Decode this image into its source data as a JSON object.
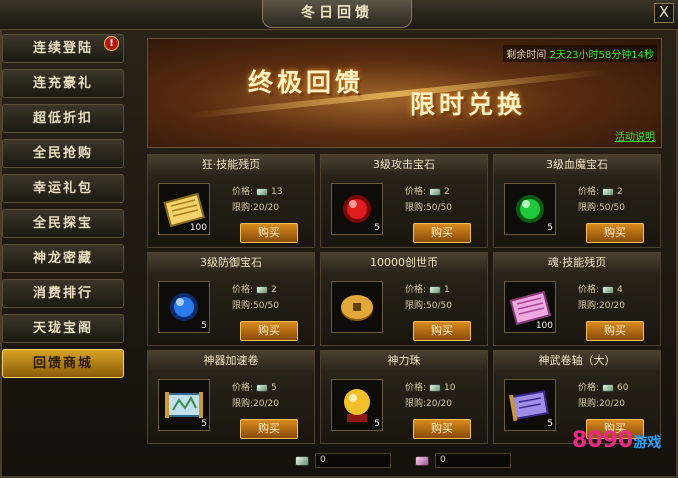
{
  "window": {
    "title": "冬日回馈",
    "close_label": "X"
  },
  "sidebar": {
    "items": [
      {
        "label": "连续登陆",
        "badge": "!"
      },
      {
        "label": "连充豪礼"
      },
      {
        "label": "超低折扣"
      },
      {
        "label": "全民抢购"
      },
      {
        "label": "幸运礼包"
      },
      {
        "label": "全民探宝"
      },
      {
        "label": "神龙密藏"
      },
      {
        "label": "消费排行"
      },
      {
        "label": "天珑宝阁"
      },
      {
        "label": "回馈商城",
        "active": true
      }
    ]
  },
  "banner": {
    "title1": "终极回馈",
    "title2": "限时兑换",
    "timer_label": "剩余时间",
    "timer_value": "2天23小时58分钟14秒",
    "rules_link": "活动说明"
  },
  "labels": {
    "price": "价格:",
    "limit": "限购:",
    "buy": "购买"
  },
  "items": [
    {
      "name": "狂·技能残页",
      "price": "13",
      "limit": "20/20",
      "qty": "100",
      "icon": "scroll-icon",
      "color": "#e8c24a"
    },
    {
      "name": "3级攻击宝石",
      "price": "2",
      "limit": "50/50",
      "qty": "5",
      "icon": "red-gem-icon",
      "color": "#d21515"
    },
    {
      "name": "3级血魔宝石",
      "price": "2",
      "limit": "50/50",
      "qty": "5",
      "icon": "green-gem-icon",
      "color": "#1fc83a"
    },
    {
      "name": "3级防御宝石",
      "price": "2",
      "limit": "50/50",
      "qty": "5",
      "icon": "blue-gem-icon",
      "color": "#2277e8"
    },
    {
      "name": "10000创世币",
      "price": "1",
      "limit": "50/50",
      "qty": "",
      "icon": "coin-icon",
      "color": "#d9a63a"
    },
    {
      "name": "魂·技能残页",
      "price": "4",
      "limit": "20/20",
      "qty": "100",
      "icon": "pink-scroll-icon",
      "color": "#e07bd0"
    },
    {
      "name": "神器加速卷",
      "price": "5",
      "limit": "20/20",
      "qty": "5",
      "icon": "map-scroll-icon",
      "color": "#9cc8e0"
    },
    {
      "name": "神力珠",
      "price": "10",
      "limit": "20/20",
      "qty": "5",
      "icon": "golden-orb-icon",
      "color": "#f2c02a"
    },
    {
      "name": "神武卷轴（大）",
      "price": "60",
      "limit": "20/20",
      "qty": "5",
      "icon": "purple-scroll-icon",
      "color": "#8a7ae0"
    }
  ],
  "bottom": {
    "currency1_value": "0",
    "currency2_value": "0"
  },
  "logo": {
    "text": "8090",
    "suffix": "游戏"
  }
}
